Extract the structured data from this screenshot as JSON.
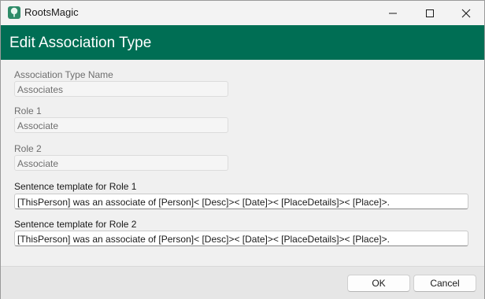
{
  "window": {
    "app_title": "RootsMagic",
    "app_icon": "tree-icon",
    "controls": [
      "minimize-icon",
      "maximize-icon",
      "close-icon"
    ]
  },
  "dialog": {
    "title": "Edit Association Type",
    "header_color": "#006e54"
  },
  "form": {
    "type_name_label": "Association Type Name",
    "type_name_value": "Associates",
    "role1_label": "Role 1",
    "role1_value": "Associate",
    "role2_label": "Role 2",
    "role2_value": "Associate",
    "template1_label": "Sentence template for Role 1",
    "template1_value": "[ThisPerson] was an associate of [Person]< [Desc]>< [Date]>< [PlaceDetails]>< [Place]>.",
    "template2_label": "Sentence template for Role 2",
    "template2_value": "[ThisPerson] was an associate of [Person]< [Desc]>< [Date]>< [PlaceDetails]>< [Place]>."
  },
  "buttons": {
    "ok_label": "OK",
    "cancel_label": "Cancel"
  }
}
